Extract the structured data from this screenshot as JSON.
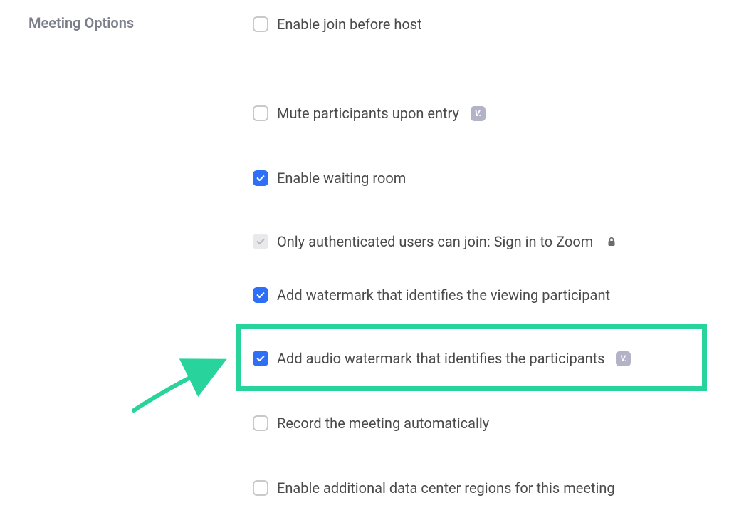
{
  "section": {
    "title": "Meeting Options"
  },
  "options": {
    "join_before_host": "Enable join before host",
    "mute_on_entry": "Mute participants upon entry",
    "waiting_room": "Enable waiting room",
    "auth_users": "Only authenticated users can join: Sign in to Zoom",
    "watermark_view": "Add watermark that identifies the viewing participant",
    "audio_watermark": "Add audio watermark that identifies the participants",
    "record_auto": "Record the meeting automatically",
    "data_center": "Enable additional data center regions for this meeting"
  },
  "badge_text": "V.",
  "colors": {
    "accent": "#2d6ff7",
    "highlight": "#29d49c",
    "label": "#7c7f8a",
    "text": "#4a4a4a",
    "badge": "#b2b3c6"
  }
}
